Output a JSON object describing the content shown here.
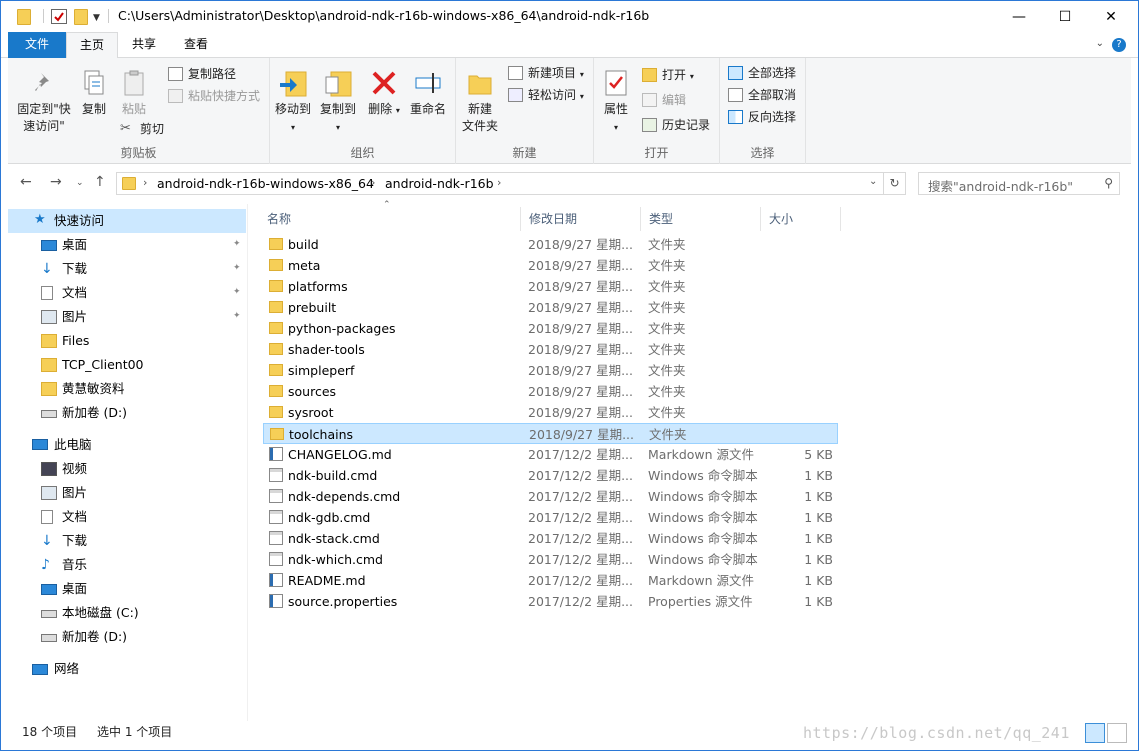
{
  "window": {
    "title": "C:\\Users\\Administrator\\Desktop\\android-ndk-r16b-windows-x86_64\\android-ndk-r16b",
    "minimize": "—",
    "maximize": "☐",
    "close": "✕"
  },
  "ribbon_tabs": {
    "file": "文件",
    "home": "主页",
    "share": "共享",
    "view": "查看"
  },
  "ribbon": {
    "pin_quick_line1": "固定到\"快",
    "pin_quick_line2": "速访问\"",
    "copy": "复制",
    "paste": "粘贴",
    "copy_path": "复制路径",
    "paste_shortcut": "粘贴快捷方式",
    "cut": "剪切",
    "group_clipboard": "剪贴板",
    "move_to": "移动到",
    "copy_to": "复制到",
    "delete": "删除",
    "rename": "重命名",
    "group_organize": "组织",
    "new_folder_line1": "新建",
    "new_folder_line2": "文件夹",
    "new_item": "新建项目",
    "easy_access": "轻松访问",
    "group_new": "新建",
    "properties": "属性",
    "open": "打开",
    "edit": "编辑",
    "history": "历史记录",
    "group_open": "打开",
    "select_all": "全部选择",
    "select_none": "全部取消",
    "invert_selection": "反向选择",
    "group_select": "选择"
  },
  "address": {
    "crumbs": [
      "android-ndk-r16b-windows-x86_64",
      "android-ndk-r16b"
    ],
    "search_placeholder": "搜索\"android-ndk-r16b\""
  },
  "nav_pane": {
    "quick_access": "快速访问",
    "quick_items": [
      "桌面",
      "下载",
      "文档",
      "图片",
      "Files",
      "TCP_Client00",
      "黄慧敏资料",
      "新加卷 (D:)"
    ],
    "this_pc": "此电脑",
    "pc_items": [
      "视频",
      "图片",
      "文档",
      "下载",
      "音乐",
      "桌面",
      "本地磁盘 (C:)",
      "新加卷 (D:)"
    ],
    "network": "网络"
  },
  "columns": {
    "name": "名称",
    "date": "修改日期",
    "type": "类型",
    "size": "大小"
  },
  "files": [
    {
      "name": "build",
      "date": "2018/9/27 星期...",
      "type": "文件夹",
      "size": "",
      "kind": "folder"
    },
    {
      "name": "meta",
      "date": "2018/9/27 星期...",
      "type": "文件夹",
      "size": "",
      "kind": "folder"
    },
    {
      "name": "platforms",
      "date": "2018/9/27 星期...",
      "type": "文件夹",
      "size": "",
      "kind": "folder"
    },
    {
      "name": "prebuilt",
      "date": "2018/9/27 星期...",
      "type": "文件夹",
      "size": "",
      "kind": "folder"
    },
    {
      "name": "python-packages",
      "date": "2018/9/27 星期...",
      "type": "文件夹",
      "size": "",
      "kind": "folder"
    },
    {
      "name": "shader-tools",
      "date": "2018/9/27 星期...",
      "type": "文件夹",
      "size": "",
      "kind": "folder"
    },
    {
      "name": "simpleperf",
      "date": "2018/9/27 星期...",
      "type": "文件夹",
      "size": "",
      "kind": "folder"
    },
    {
      "name": "sources",
      "date": "2018/9/27 星期...",
      "type": "文件夹",
      "size": "",
      "kind": "folder"
    },
    {
      "name": "sysroot",
      "date": "2018/9/27 星期...",
      "type": "文件夹",
      "size": "",
      "kind": "folder"
    },
    {
      "name": "toolchains",
      "date": "2018/9/27 星期...",
      "type": "文件夹",
      "size": "",
      "kind": "folder",
      "selected": true
    },
    {
      "name": "CHANGELOG.md",
      "date": "2017/12/2 星期...",
      "type": "Markdown 源文件",
      "size": "5 KB",
      "kind": "md"
    },
    {
      "name": "ndk-build.cmd",
      "date": "2017/12/2 星期...",
      "type": "Windows 命令脚本",
      "size": "1 KB",
      "kind": "cmd"
    },
    {
      "name": "ndk-depends.cmd",
      "date": "2017/12/2 星期...",
      "type": "Windows 命令脚本",
      "size": "1 KB",
      "kind": "cmd"
    },
    {
      "name": "ndk-gdb.cmd",
      "date": "2017/12/2 星期...",
      "type": "Windows 命令脚本",
      "size": "1 KB",
      "kind": "cmd"
    },
    {
      "name": "ndk-stack.cmd",
      "date": "2017/12/2 星期...",
      "type": "Windows 命令脚本",
      "size": "1 KB",
      "kind": "cmd"
    },
    {
      "name": "ndk-which.cmd",
      "date": "2017/12/2 星期...",
      "type": "Windows 命令脚本",
      "size": "1 KB",
      "kind": "cmd"
    },
    {
      "name": "README.md",
      "date": "2017/12/2 星期...",
      "type": "Markdown 源文件",
      "size": "1 KB",
      "kind": "md"
    },
    {
      "name": "source.properties",
      "date": "2017/12/2 星期...",
      "type": "Properties 源文件",
      "size": "1 KB",
      "kind": "md"
    }
  ],
  "status": {
    "count": "18 个项目",
    "selected": "选中 1 个项目",
    "watermark": "https://blog.csdn.net/qq_241"
  },
  "colors": {
    "accent": "#1979ca",
    "selection": "#cce8ff",
    "folder": "#f6cf57"
  }
}
